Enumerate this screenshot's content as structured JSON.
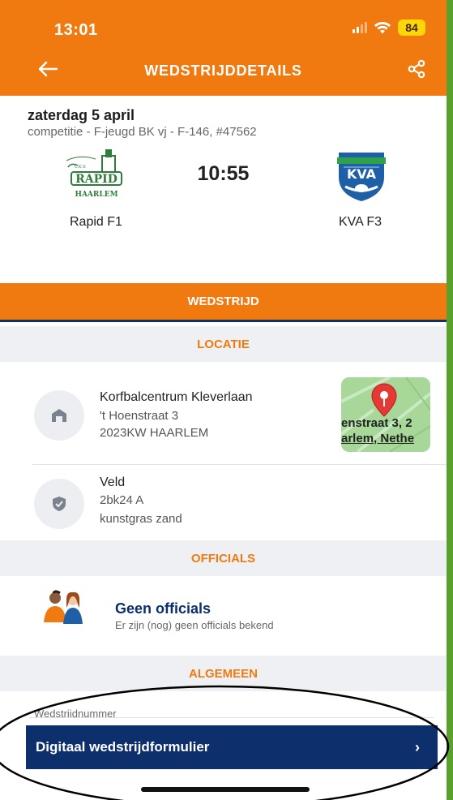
{
  "status_bar": {
    "time": "13:01",
    "battery": "84"
  },
  "header": {
    "title": "WEDSTRIJDDETAILS",
    "back_icon": "arrow-left-icon",
    "share_icon": "share-icon"
  },
  "match": {
    "date": "zaterdag 5 april",
    "competition": "competitie - F-jeugd BK vj - F-146, #47562",
    "time": "10:55",
    "home_team": "Rapid F1",
    "away_team": "KVA F3",
    "home_logo_text_top": "RAPID",
    "home_logo_text_bottom": "HAARLEM",
    "away_logo_text": "KVA"
  },
  "tab": {
    "label": "WEDSTRIJD"
  },
  "sections": {
    "locatie": "LOCATIE",
    "officials": "OFFICIALS",
    "algemeen": "ALGEMEEN"
  },
  "location": {
    "name": "Korfbalcentrum Kleverlaan",
    "street": "'t Hoenstraat 3",
    "postal_city": "2023KW HAARLEM",
    "map_line1": "enstraat 3, 2",
    "map_line2": "arlem, Nethe"
  },
  "field": {
    "title": "Veld",
    "number": "2bk24 A",
    "surface": "kunstgras zand"
  },
  "officials": {
    "title": "Geen officials",
    "subtitle": "Er zijn (nog) geen officials bekend"
  },
  "general": {
    "match_number_label": "Wedstriidnummer"
  },
  "digital_form": {
    "label": "Digitaal wedstrijdformulier"
  },
  "colors": {
    "primary_orange": "#f07a10",
    "navy": "#0d2f6b",
    "section_bg": "#eef0f3",
    "frame_green": "#5aa02c"
  }
}
